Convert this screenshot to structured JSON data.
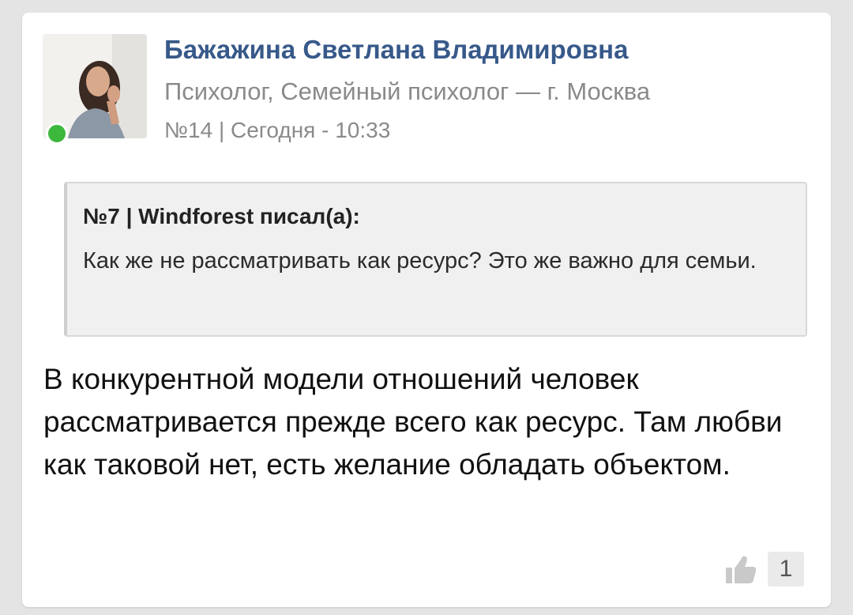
{
  "post": {
    "author": {
      "name": "Бажажина Светлана Владимировна",
      "role": "Психолог, Семейный психолог — г. Москва",
      "online": true
    },
    "meta": "№14 | Сегодня - 10:33",
    "quote": {
      "header": "№7 | Windforest писал(а):",
      "text": "Как же не рассматривать как ресурс? Это же важно для семьи."
    },
    "text": "В конкурентной модели отношений человек рассматривается прежде всего как ресурс. Там любви как таковой нет, есть желание обладать объектом.",
    "likes": {
      "icon": "thumbs-up-icon",
      "count": "1"
    }
  },
  "colors": {
    "author_name": "#37598a",
    "online": "#3cb83c",
    "secondary_text": "#8a8a8a",
    "quote_background": "#f0f0f0"
  }
}
